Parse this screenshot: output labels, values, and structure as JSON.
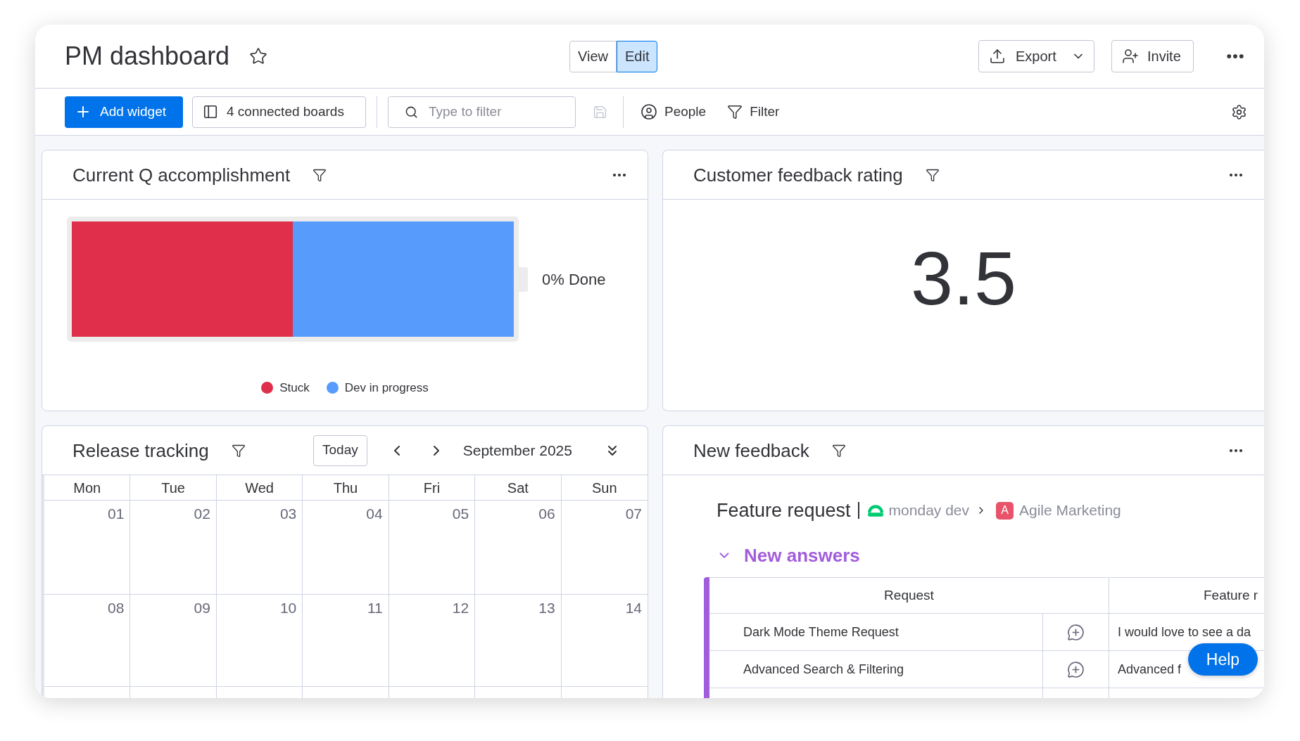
{
  "header": {
    "title": "PM dashboard",
    "view_toggle": [
      {
        "label": "View",
        "selected": false
      },
      {
        "label": "Edit",
        "selected": true
      }
    ],
    "export_button": {
      "label": "Export"
    },
    "invite_button": {
      "label": "Invite"
    }
  },
  "toolbar": {
    "add_widget_button": "Add widget",
    "boards_button": "4 connected boards",
    "filter_field": {
      "placeholder": "Type to filter"
    },
    "people_button": "People",
    "filter_button": "Filter"
  },
  "widgets": [
    {
      "kind": "battery",
      "title": "Current Q accomplishment",
      "level": 0.5,
      "reading": "0% Done",
      "legend": [
        {
          "label": "Stuck",
          "color": "#df2f4a"
        },
        {
          "label": "Dev in progress",
          "color": "#579bfc"
        }
      ]
    },
    {
      "kind": "number",
      "title": "Customer feedback rating",
      "value": "3.5"
    },
    {
      "kind": "calendar",
      "title": "Release tracking",
      "today_button": "Today",
      "month": "September 2025",
      "weekdays": [
        "Mon",
        "Tue",
        "Wed",
        "Thu",
        "Fri",
        "Sat",
        "Sun"
      ],
      "weeks": [
        [
          "01",
          "02",
          "03",
          "04",
          "05",
          "06",
          "07"
        ],
        [
          "08",
          "09",
          "10",
          "11",
          "12",
          "13",
          "14"
        ]
      ]
    },
    {
      "kind": "feedback",
      "title": "New feedback",
      "board": "Feature request",
      "workspace": "monday dev",
      "folder_badge": "A",
      "folder": "Agile Marketing",
      "group": {
        "title": "New answers",
        "expanded": true
      },
      "columns": [
        "Request",
        "Feature r"
      ],
      "rows": [
        {
          "request": "Dark Mode Theme Request",
          "feature": "I would love to see a da"
        },
        {
          "request": "Advanced Search & Filtering",
          "feature": "Advanced f"
        }
      ]
    }
  ],
  "help_button": "Help"
}
